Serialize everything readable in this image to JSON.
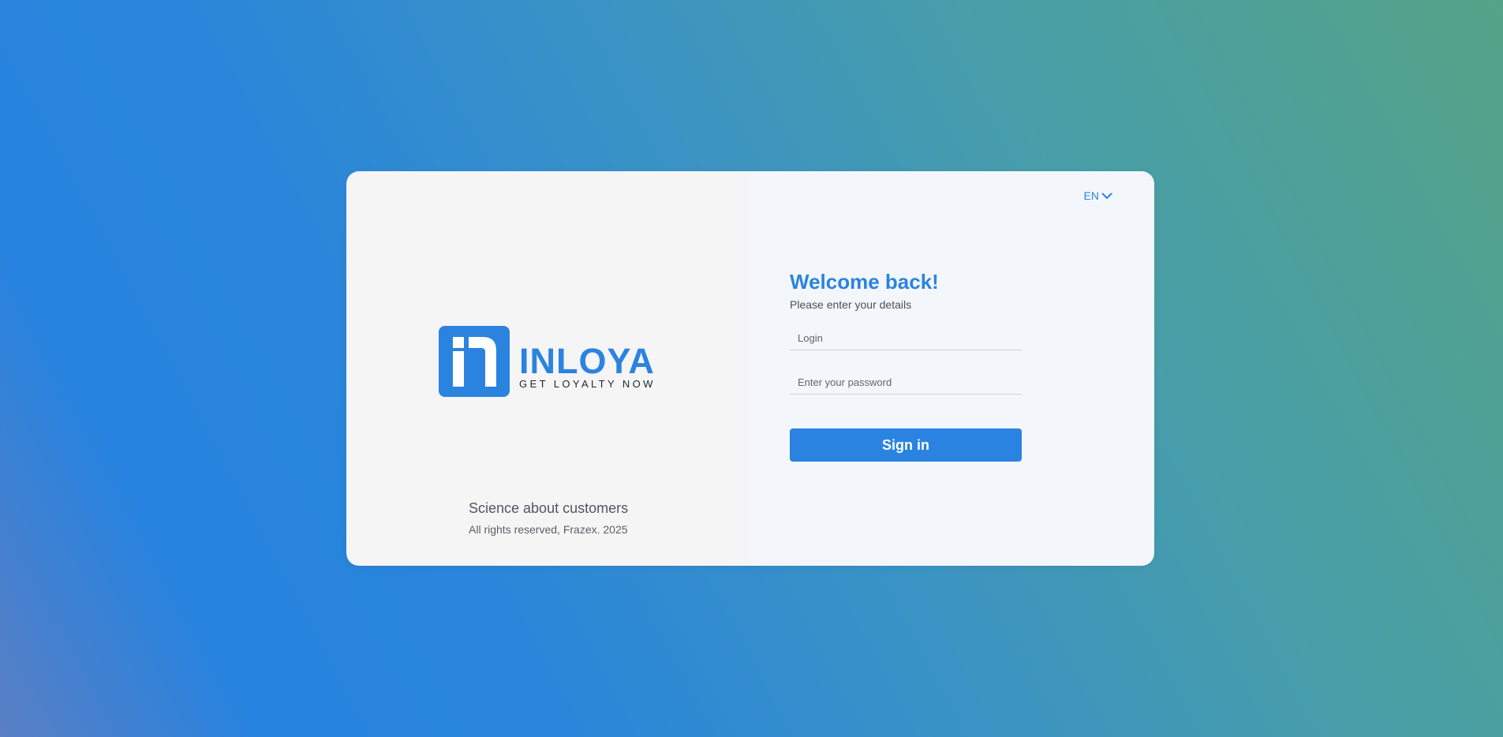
{
  "brand": {
    "name": "INLOYA",
    "tagline": "GET LOYALTY NOW",
    "logo_icon": "inloya-logo-mark",
    "brand_color": "#2b83e0"
  },
  "left_footer": {
    "title": "Science about customers",
    "copyright": "All rights reserved, Frazex. 2025"
  },
  "language": {
    "selected": "EN",
    "icon": "chevron-down-icon"
  },
  "login_form": {
    "heading": "Welcome back!",
    "subtitle": "Please enter your details",
    "login_placeholder": "Login",
    "login_value": "",
    "password_placeholder": "Enter your password",
    "password_value": "",
    "submit_label": "Sign in"
  }
}
